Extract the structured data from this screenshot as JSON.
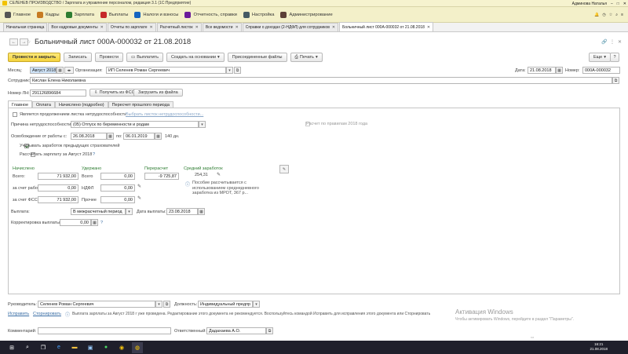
{
  "titlebar": {
    "title": "СЕЛЕНЕВ ПРОИЗВОДСТВО / Зарплата и управление персоналом, редакция 3.1 (1С:Предприятие)",
    "user": "Админова Наталья"
  },
  "sections": [
    {
      "label": "Главное",
      "icon": "menu-icon"
    },
    {
      "label": "Кадры",
      "icon": "people-icon"
    },
    {
      "label": "Зарплата",
      "icon": "wallet-icon"
    },
    {
      "label": "Выплаты",
      "icon": "money-icon"
    },
    {
      "label": "Налоги и взносы",
      "icon": "percent-icon"
    },
    {
      "label": "Отчетность, справки",
      "icon": "report-icon"
    },
    {
      "label": "Настройка",
      "icon": "settings-icon"
    },
    {
      "label": "Администрирование",
      "icon": "admin-icon"
    }
  ],
  "tabs": [
    {
      "label": "Начальная страница",
      "active": false
    },
    {
      "label": "Все кадровые документы",
      "active": false
    },
    {
      "label": "Отчеты по зарплате",
      "active": false
    },
    {
      "label": "Расчетный листок",
      "active": false
    },
    {
      "label": "Все ведомости",
      "active": false
    },
    {
      "label": "Справки о доходах (2-НДФЛ) для сотрудников",
      "active": false
    },
    {
      "label": "Больничный лист 000А-000032 от 21.08.2018",
      "active": true
    }
  ],
  "doc": {
    "title": "Больничный лист 000А-000032 от 21.08.2018"
  },
  "toolbar": {
    "post_close": "Провести и закрыть",
    "save": "Записать",
    "post": "Провести",
    "pay": "Выплатить",
    "create_based": "Создать на основании",
    "attached": "Присоединенные файлы",
    "print": "Печать",
    "more": "Еще",
    "help": "?"
  },
  "header": {
    "month_label": "Месяц:",
    "month_value": "Август 2018",
    "org_label": "Организация:",
    "org_value": "ИП Селенев Роман Сергеевич",
    "date_label": "Дата:",
    "date_value": "21.08.2018",
    "number_label": "Номер:",
    "number_value": "000А-000032",
    "employee_label": "Сотрудник:",
    "employee_value": "Кислан Елена Николаевна",
    "ln_label": "Номер ЛН:",
    "ln_value": "291126896684",
    "fss_get": "Получить из ФСС",
    "load_file": "Загрузить из файла"
  },
  "inner_tabs": [
    {
      "label": "Главное",
      "active": true
    },
    {
      "label": "Оплата",
      "active": false
    },
    {
      "label": "Начислено (подробно)",
      "active": false
    },
    {
      "label": "Пересчет прошлого периода",
      "active": false
    }
  ],
  "main": {
    "continuation_label": "Является продолжением листка нетрудоспособности",
    "continuation_link": "Выбрать листок нетрудоспособности...",
    "reason_label": "Причина нетрудоспособности:",
    "reason_value": "(05) Отпуск по беременности и родам",
    "rules_2018_label": "Расчет по правилам 2018 года",
    "release_label": "Освобождение от работы с:",
    "release_from": "26.08.2018",
    "release_to_label": "по:",
    "release_to": "06.01.2019",
    "days": "140 дн.",
    "prev_insurers_label": "Учитывать заработок предыдущих страхователей",
    "calc_salary_label": "Рассчитать зарплату за Август 2018",
    "calc_salary_q": "?",
    "accrued_h": "Начислено",
    "withheld_h": "Удержано",
    "recalc_h": "Перерасчет",
    "avg_h": "Средний заработок",
    "total_label": "Всего:",
    "total_value": "71 932,00",
    "withheld_total_label": "Всего",
    "withheld_total_value": "0,00",
    "recalc_value": "-9 725,87",
    "avg_value": "254,31",
    "employer_label": "за счет работ.",
    "employer_value": "0,00",
    "ndfl_label": "НДФЛ",
    "ndfl_value": "0,00",
    "fss_label": "за счет ФСС",
    "fss_value": "71 932,00",
    "other_label": "Прочее",
    "other_value": "0,00",
    "note": "Пособие рассчитывается с использованием среднедневного заработка из МРОТ, 367 р...",
    "payout_label": "Выплата:",
    "payout_value": "В межрасчетный период",
    "payout_date_label": "Дата выплаты:",
    "payout_date_value": "23.08.2018",
    "correction_label": "Корректировка выплаты:",
    "correction_value": "0,00",
    "correction_q": "?"
  },
  "bottom": {
    "head_label": "Руководитель:",
    "head_value": "Селенев Роман Сергеевич",
    "position_label": "Должность:",
    "position_value": "Индивидуальный предпр",
    "fix_link": "Исправить",
    "cancel_link": "Сторнировать",
    "info": "Выплата зарплаты за Август 2018 г уже проведена. Редактирование этого документа не рекомендуется. Воспользуйтесь командой Исправить для исправления этого документа или Сторнировать",
    "comment_label": "Комментарий:",
    "responsible_label": "Ответственный:",
    "responsible_value": "Дадахаева А.О."
  },
  "watermark": {
    "line1": "Активация Windows",
    "line2": "Чтобы активировать Windows, перейдите в раздел \"Параметры\"."
  },
  "clock": {
    "time": "16:21",
    "date": "21.08.2018"
  }
}
